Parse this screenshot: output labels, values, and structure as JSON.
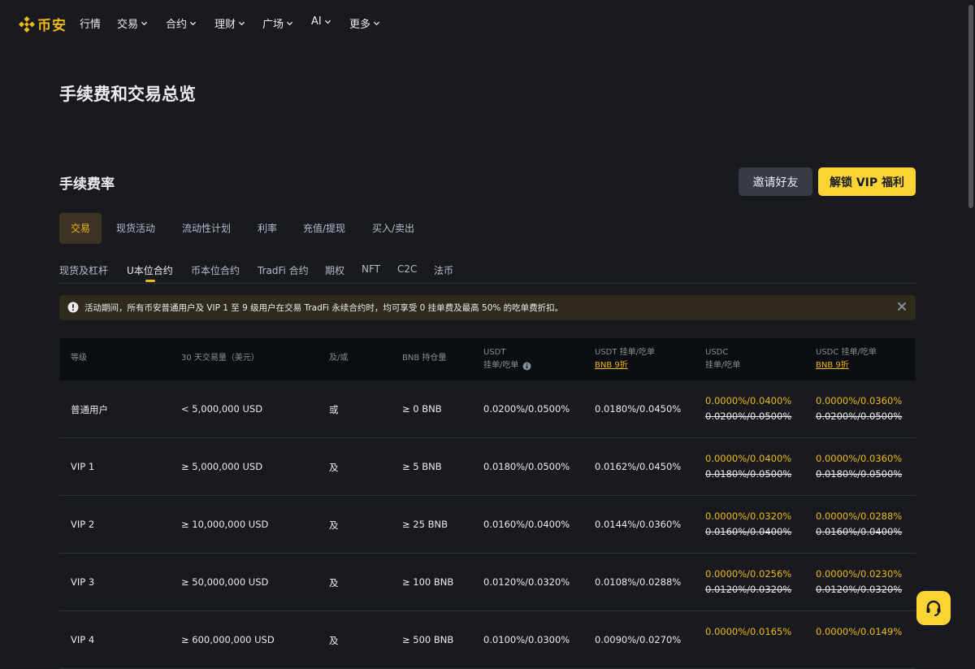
{
  "nav": {
    "logo_text": "币安",
    "items": [
      {
        "label": "行情",
        "has_dropdown": false
      },
      {
        "label": "交易",
        "has_dropdown": true
      },
      {
        "label": "合约",
        "has_dropdown": true
      },
      {
        "label": "理财",
        "has_dropdown": true
      },
      {
        "label": "广场",
        "has_dropdown": true
      },
      {
        "label": "AI",
        "has_dropdown": true
      },
      {
        "label": "更多",
        "has_dropdown": true
      }
    ]
  },
  "page_title": "手续费和交易总览",
  "section_title": "手续费率",
  "buttons": {
    "invite": "邀请好友",
    "unlock_vip": "解锁 VIP 福利"
  },
  "tabs_primary": [
    {
      "label": "交易",
      "active": true
    },
    {
      "label": "现货活动",
      "active": false
    },
    {
      "label": "流动性计划",
      "active": false
    },
    {
      "label": "利率",
      "active": false
    },
    {
      "label": "充值/提现",
      "active": false
    },
    {
      "label": "买入/卖出",
      "active": false
    }
  ],
  "tabs_secondary": [
    {
      "label": "现货及杠杆",
      "active": false
    },
    {
      "label": "U本位合约",
      "active": true
    },
    {
      "label": "币本位合约",
      "active": false
    },
    {
      "label": "TradFi 合约",
      "active": false
    },
    {
      "label": "期权",
      "active": false
    },
    {
      "label": "NFT",
      "active": false
    },
    {
      "label": "C2C",
      "active": false
    },
    {
      "label": "法币",
      "active": false
    }
  ],
  "notice": {
    "text": "活动期间，所有币安普通用户及 VIP 1 至 9 级用户在交易 TradFi 永续合约时，均可享受 0 挂单费及最高 50% 的吃单费折扣。"
  },
  "table": {
    "headers": {
      "level": "等级",
      "volume": "30 天交易量（美元）",
      "andor": "及/或",
      "bnb": "BNB 持仓量",
      "usdt_line1": "USDT",
      "usdt_line2": "挂单/吃单",
      "usdt_bnb_line1": "USDT 挂单/吃单",
      "usdt_bnb_link": "BNB 9折",
      "usdc_line1": "USDC",
      "usdc_line2": "挂单/吃单",
      "usdc_bnb_line1": "USDC 挂单/吃单",
      "usdc_bnb_link": "BNB 9折"
    },
    "rows": [
      {
        "level": "普通用户",
        "volume": "< 5,000,000 USD",
        "andor": "或",
        "bnb": "≥ 0 BNB",
        "usdt": "0.0200%/0.0500%",
        "usdt_bnb": "0.0180%/0.0450%",
        "usdc_new": "0.0000%/0.0400%",
        "usdc_old": "0.0200%/0.0500%",
        "usdc_bnb_new": "0.0000%/0.0360%",
        "usdc_bnb_old": "0.0200%/0.0500%"
      },
      {
        "level": "VIP 1",
        "volume": "≥ 5,000,000 USD",
        "andor": "及",
        "bnb": "≥ 5 BNB",
        "usdt": "0.0180%/0.0500%",
        "usdt_bnb": "0.0162%/0.0450%",
        "usdc_new": "0.0000%/0.0400%",
        "usdc_old": "0.0180%/0.0500%",
        "usdc_bnb_new": "0.0000%/0.0360%",
        "usdc_bnb_old": "0.0180%/0.0500%"
      },
      {
        "level": "VIP 2",
        "volume": "≥ 10,000,000 USD",
        "andor": "及",
        "bnb": "≥ 25 BNB",
        "usdt": "0.0160%/0.0400%",
        "usdt_bnb": "0.0144%/0.0360%",
        "usdc_new": "0.0000%/0.0320%",
        "usdc_old": "0.0160%/0.0400%",
        "usdc_bnb_new": "0.0000%/0.0288%",
        "usdc_bnb_old": "0.0160%/0.0400%"
      },
      {
        "level": "VIP 3",
        "volume": "≥ 50,000,000 USD",
        "andor": "及",
        "bnb": "≥ 100 BNB",
        "usdt": "0.0120%/0.0320%",
        "usdt_bnb": "0.0108%/0.0288%",
        "usdc_new": "0.0000%/0.0256%",
        "usdc_old": "0.0120%/0.0320%",
        "usdc_bnb_new": "0.0000%/0.0230%",
        "usdc_bnb_old": "0.0120%/0.0320%"
      },
      {
        "level": "VIP 4",
        "volume": "≥ 600,000,000 USD",
        "andor": "及",
        "bnb": "≥ 500 BNB",
        "usdt": "0.0100%/0.0300%",
        "usdt_bnb": "0.0090%/0.0270%",
        "usdc_new": "0.0000%/0.0165%",
        "usdc_old": "",
        "usdc_bnb_new": "0.0000%/0.0149%",
        "usdc_bnb_old": ""
      }
    ]
  },
  "colors": {
    "background": "#181a20",
    "accent": "#f0b90b",
    "button_primary": "#fcd535",
    "button_secondary": "#363b44",
    "table_header_bg": "#0b0e11",
    "notice_bg": "#302a1d"
  },
  "icons": [
    "binance-logo-icon",
    "chevron-down-icon",
    "exclamation-circle-icon",
    "info-icon",
    "close-icon",
    "headset-icon"
  ]
}
